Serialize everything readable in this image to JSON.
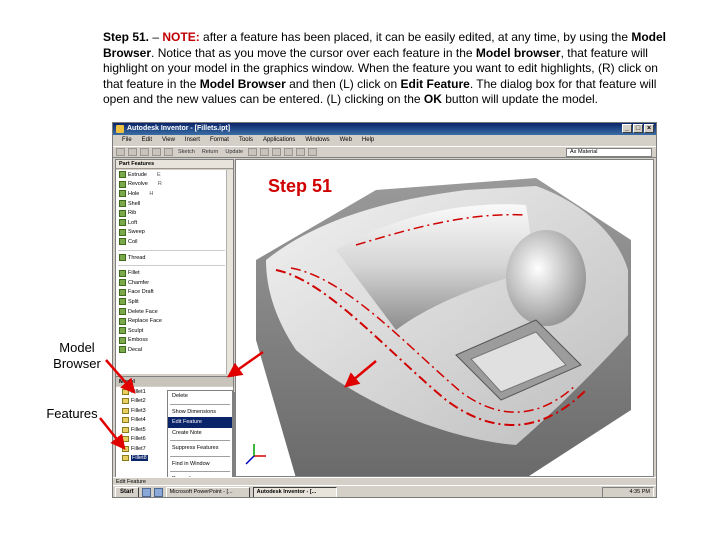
{
  "instructions": {
    "step": "Step 51.",
    "dash": " – ",
    "note_label": "NOTE:",
    "t1": " after a feature has been placed, it can be easily edited, at any time, by using the ",
    "b1": "Model Browser",
    "t2": ". Notice that as you move the cursor over each feature in the ",
    "b2": "Model browser",
    "t3": ", that feature will highlight on your model in the graphics window. When the feature you want to edit highlights, (R) click on that feature in the ",
    "b3": "Model Browser",
    "t4": " and then (L) click on ",
    "b4": "Edit Feature",
    "t5": ". The dialog box for that feature will open and the new values can be entered. (L) clicking on the ",
    "b5": "OK",
    "t6": " button will update the model."
  },
  "labels": {
    "model_browser": "Model Browser",
    "features": "Features",
    "step_title": "Step 51"
  },
  "app": {
    "title": "Autodesk Inventor - [Fillets.ipt]",
    "menus": [
      "File",
      "Edit",
      "View",
      "Insert",
      "Format",
      "Tools",
      "Applications",
      "Windows",
      "Web",
      "Help"
    ],
    "toolbar_return": "Return",
    "toolbar_sketch": "Sketch",
    "toolbar_update": "Update",
    "material": "As Material",
    "panel_title": "Part Features",
    "features": [
      {
        "label": "Extrude",
        "key": "E"
      },
      {
        "label": "Revolve",
        "key": "R"
      },
      {
        "label": "Hole",
        "key": "H"
      },
      {
        "label": "Shell",
        "key": ""
      },
      {
        "label": "Rib",
        "key": ""
      },
      {
        "label": "Loft",
        "key": ""
      },
      {
        "label": "Sweep",
        "key": ""
      },
      {
        "label": "Coil",
        "key": ""
      },
      {
        "label": "Thread",
        "key": ""
      },
      {
        "label": "Fillet",
        "key": ""
      },
      {
        "label": "Chamfer",
        "key": ""
      },
      {
        "label": "Face Draft",
        "key": ""
      },
      {
        "label": "Split",
        "key": ""
      },
      {
        "label": "Delete Face",
        "key": ""
      },
      {
        "label": "Replace Face",
        "key": ""
      },
      {
        "label": "Sculpt",
        "key": ""
      },
      {
        "label": "Emboss",
        "key": ""
      },
      {
        "label": "Decal",
        "key": ""
      }
    ],
    "browser_title": "Model",
    "browser_items": [
      "Fillet1",
      "Fillet2",
      "Fillet3",
      "Fillet4",
      "Fillet5",
      "Fillet6",
      "Fillet7",
      "Fillet8"
    ],
    "context_menu": [
      "Delete",
      "Show Dimensions",
      "Edit Feature",
      "Create Note",
      "Suppress Features",
      "Find in Window",
      "Properties",
      "How To..."
    ],
    "status": "Edit Feature",
    "start": "Start",
    "tasks": [
      "Microsoft PowerPoint - [...",
      "Autodesk Inventor - [..."
    ],
    "clock": "4:35 PM"
  }
}
